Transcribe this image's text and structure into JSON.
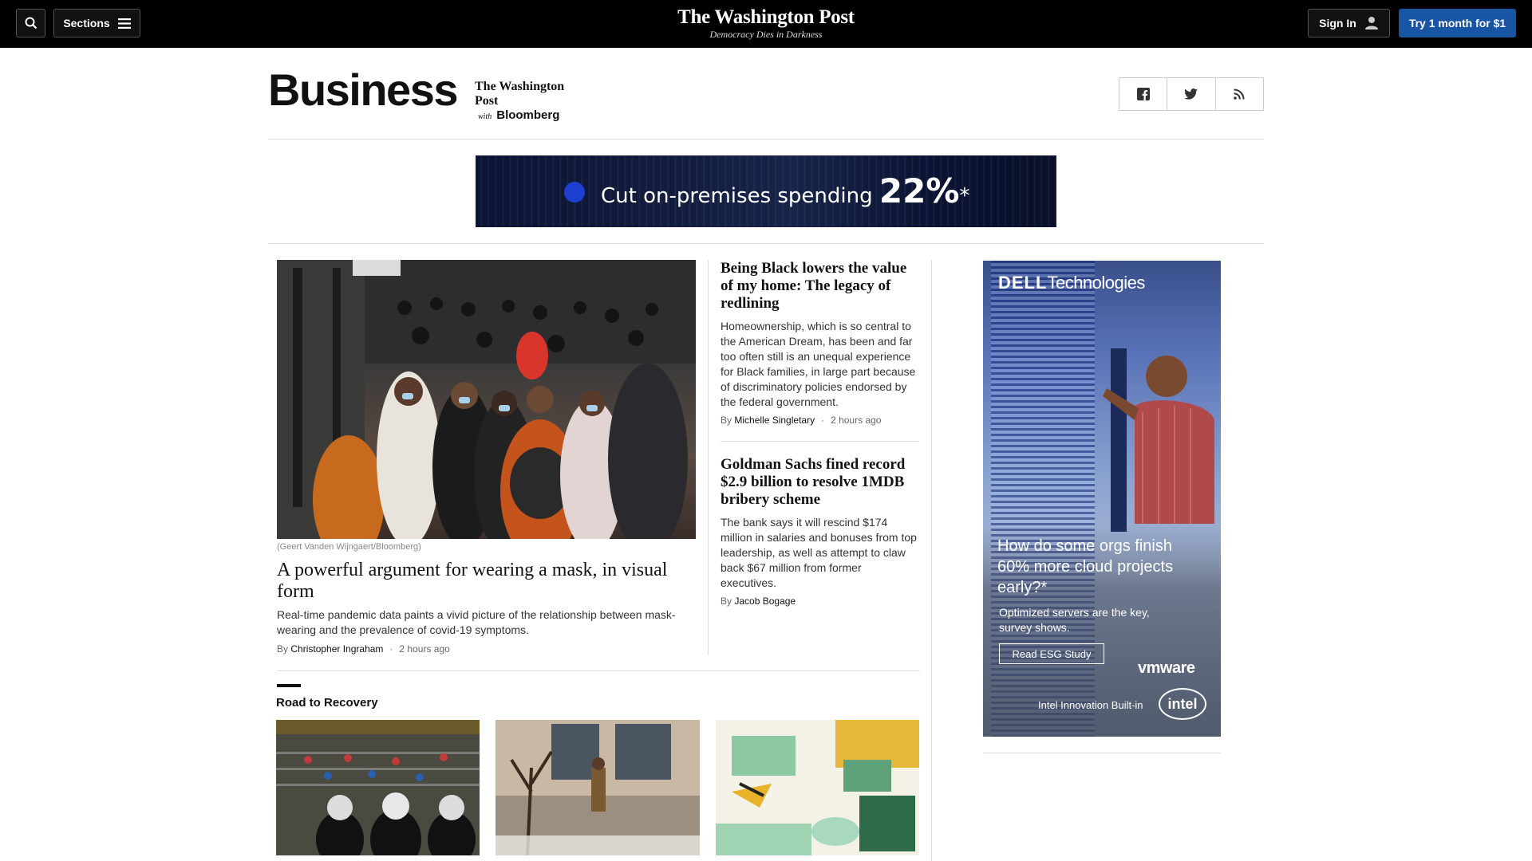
{
  "topbar": {
    "sections_label": "Sections",
    "logo": "The Washington Post",
    "tagline": "Democracy Dies in Darkness",
    "signin_label": "Sign In",
    "cta_label": "Try 1 month for $1"
  },
  "section": {
    "title": "Business",
    "partner_post": "The Washington Post",
    "partner_with": "with",
    "partner_bloomberg": "Bloomberg"
  },
  "share": [
    "facebook-icon",
    "twitter-icon",
    "rss-icon"
  ],
  "banner_ad": {
    "text": "Cut on-premises spending",
    "figure": "22%",
    "mark": "*"
  },
  "lead": {
    "caption": "(Geert Vanden Wijngaert/Bloomberg)",
    "headline": "A powerful argument for wearing a mask, in visual form",
    "blurb": "Real-time pandemic data paints a vivid picture of the relationship between mask-wearing and the prevalence of covid-19 symptoms.",
    "by": "By",
    "author": "Christopher Ingraham",
    "time": "2 hours ago"
  },
  "stories": [
    {
      "headline": "Being Black lowers the value of my home: The legacy of redlining",
      "blurb": "Homeownership, which is so central to the American Dream, has been and far too often still is an unequal experience for Black families, in large part because of discriminatory policies endorsed by the federal government.",
      "by": "By",
      "author": "Michelle Singletary",
      "time": "2 hours ago"
    },
    {
      "headline": "Goldman Sachs fined record $2.9 billion to resolve 1MDB bribery scheme",
      "blurb": "The bank says it will rescind $174 million in salaries and bonuses from top leadership, as well as attempt to claw back $67 million from former executives.",
      "by": "By",
      "author": "Jacob Bogage"
    }
  ],
  "road_to_recovery": {
    "title": "Road to Recovery"
  },
  "side_ad": {
    "brand_bold": "DELL",
    "brand_rest": "Technologies",
    "question": "How do some orgs finish 60% more cloud projects early?*",
    "sub": "Optimized servers are the key, survey shows.",
    "cta": "Read ESG Study",
    "vmware": "vmware",
    "intel_line": "Intel Innovation Built-in",
    "intel_logo": "intel"
  },
  "colors": {
    "topbar_bg": "#000000",
    "cta_blue": "#1955a5",
    "divider": "#dddddd"
  }
}
